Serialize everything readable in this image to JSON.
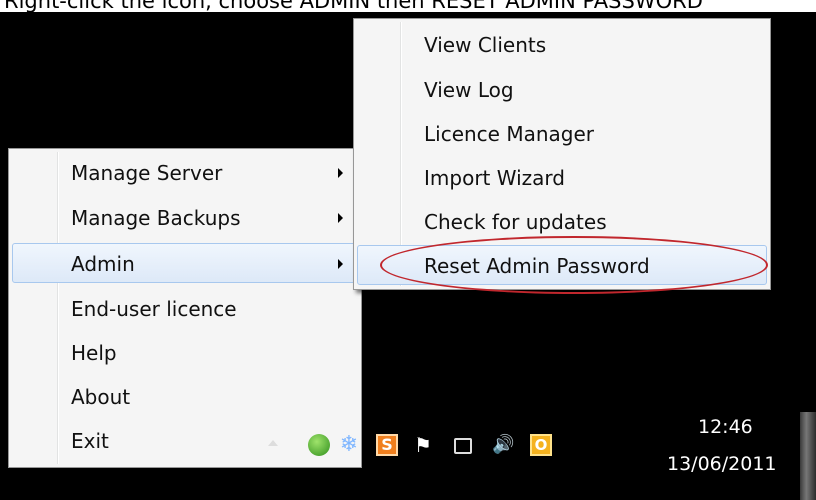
{
  "caption": "Right-click the icon, choose ADMIN then RESET ADMIN PASSWORD",
  "main_menu": [
    {
      "label": "Manage Server",
      "has_submenu": true,
      "highlighted": false
    },
    {
      "label": "Manage Backups",
      "has_submenu": true,
      "highlighted": false
    },
    {
      "label": "Admin",
      "has_submenu": true,
      "highlighted": true
    },
    {
      "label": "End-user licence",
      "has_submenu": false,
      "highlighted": false
    },
    {
      "label": "Help",
      "has_submenu": false,
      "highlighted": false
    },
    {
      "label": "About",
      "has_submenu": false,
      "highlighted": false
    },
    {
      "label": "Exit",
      "has_submenu": false,
      "highlighted": false
    }
  ],
  "admin_submenu": [
    {
      "label": "View Clients",
      "highlighted": false
    },
    {
      "label": "View Log",
      "highlighted": false
    },
    {
      "label": "Licence Manager",
      "highlighted": false
    },
    {
      "label": "Import Wizard",
      "highlighted": false
    },
    {
      "label": "Check for updates",
      "highlighted": false
    },
    {
      "label": "Reset Admin Password",
      "highlighted": true
    }
  ],
  "taskbar": {
    "tray_icons": [
      "show-hidden-icons-arrow",
      "green-app-icon",
      "snowflake-icon",
      "s-app-icon",
      "action-center-flag-icon",
      "network-icon",
      "volume-icon",
      "outlook-icon"
    ],
    "clock": {
      "time": "12:46",
      "date": "13/06/2011"
    }
  },
  "colors": {
    "highlight_border": "#a8c8ee",
    "annotation_circle": "#c1272d",
    "menu_background": "#f5f5f5"
  }
}
